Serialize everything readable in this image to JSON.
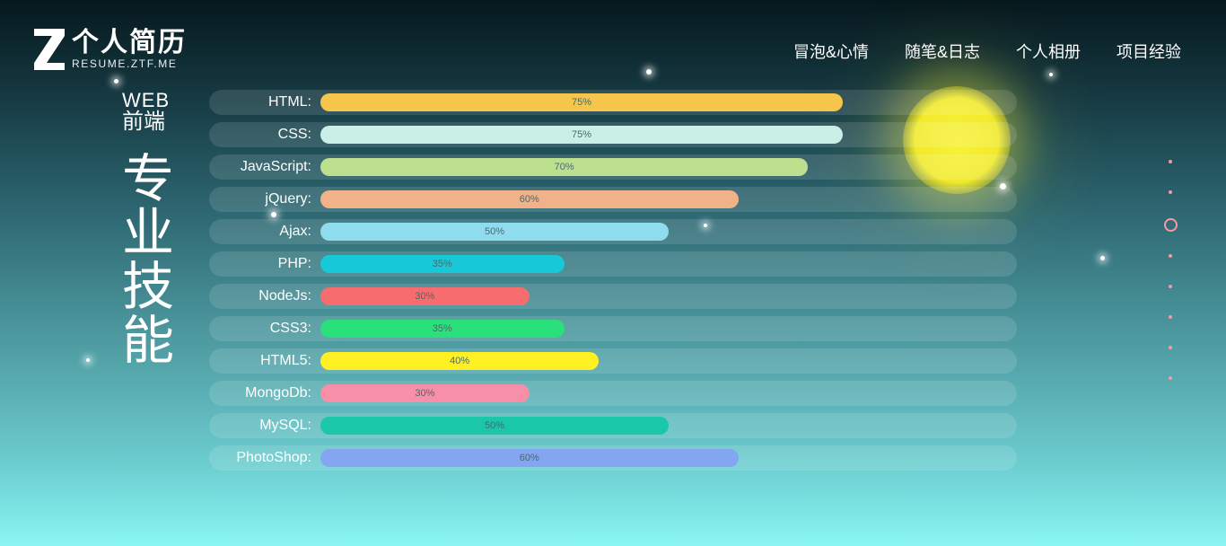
{
  "logo": {
    "title": "个人简历",
    "subtitle": "RESUME.ZTF.ME"
  },
  "nav": [
    {
      "label": "冒泡&心情"
    },
    {
      "label": "随笔&日志"
    },
    {
      "label": "个人相册"
    },
    {
      "label": "项目经验"
    }
  ],
  "section": {
    "tag_top": "WEB",
    "tag_sub": "前端",
    "title_chars": [
      "专",
      "业",
      "技",
      "能"
    ]
  },
  "skills": [
    {
      "name": "HTML:",
      "percent": 75,
      "text": "75%",
      "color": "#f6c54b"
    },
    {
      "name": "CSS:",
      "percent": 75,
      "text": "75%",
      "color": "#c9efe6"
    },
    {
      "name": "JavaScript:",
      "percent": 70,
      "text": "70%",
      "color": "#bde08f"
    },
    {
      "name": "jQuery:",
      "percent": 60,
      "text": "60%",
      "color": "#f1b28a"
    },
    {
      "name": "Ajax:",
      "percent": 50,
      "text": "50%",
      "color": "#8fdcef"
    },
    {
      "name": "PHP:",
      "percent": 35,
      "text": "35%",
      "color": "#17c8d8"
    },
    {
      "name": "NodeJs:",
      "percent": 30,
      "text": "30%",
      "color": "#f76c6e"
    },
    {
      "name": "CSS3:",
      "percent": 35,
      "text": "35%",
      "color": "#2ae07a"
    },
    {
      "name": "HTML5:",
      "percent": 40,
      "text": "40%",
      "color": "#fff024"
    },
    {
      "name": "MongoDb:",
      "percent": 30,
      "text": "30%",
      "color": "#f78fa9"
    },
    {
      "name": "MySQL:",
      "percent": 50,
      "text": "50%",
      "color": "#1ac7a9"
    },
    {
      "name": "PhotoShop:",
      "percent": 60,
      "text": "60%",
      "color": "#83a5f2"
    }
  ],
  "page_dots": {
    "count": 8,
    "active_index": 2
  },
  "colors": {
    "dot": "#f59aa8",
    "moon": "#f8f23a"
  }
}
